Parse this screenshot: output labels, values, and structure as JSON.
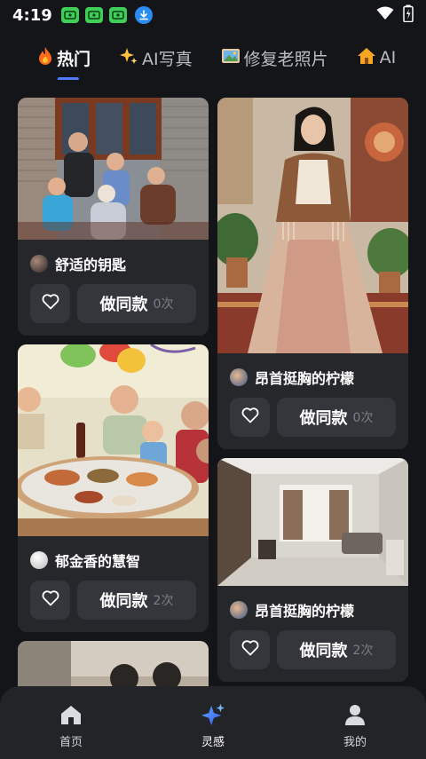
{
  "status_bar": {
    "time": "4:19",
    "notification_icons": [
      "cash-app-icon",
      "cash-app-icon",
      "cash-app-icon",
      "download-icon"
    ],
    "right_icons": [
      "wifi-icon",
      "battery-icon"
    ]
  },
  "tabs": [
    {
      "label": "热门",
      "icon": "fire-icon",
      "active": true
    },
    {
      "label": "AI写真",
      "icon": "sparkle-icon",
      "active": false
    },
    {
      "label": "修复老照片",
      "icon": "photo-icon",
      "active": false
    },
    {
      "label": "AI",
      "icon": "house-icon",
      "active": false
    }
  ],
  "feed": {
    "left": [
      {
        "author": "舒适的钥匙",
        "make_label": "做同款",
        "count": "0次",
        "image": "family-photo-outdoor"
      },
      {
        "author": "郁金香的慧智",
        "make_label": "做同款",
        "count": "2次",
        "image": "family-dinner-photo"
      },
      {
        "image": "old-photo-partial"
      }
    ],
    "right": [
      {
        "author": "昂首挺胸的柠檬",
        "make_label": "做同款",
        "count": "0次",
        "image": "bohemian-dress-portrait"
      },
      {
        "author": "昂首挺胸的柠檬",
        "make_label": "做同款",
        "count": "2次",
        "image": "modern-living-room"
      }
    ]
  },
  "bottom_nav": [
    {
      "label": "首页",
      "icon": "home-icon",
      "active": false
    },
    {
      "label": "灵感",
      "icon": "sparkle-icon",
      "active": true
    },
    {
      "label": "我的",
      "icon": "profile-icon",
      "active": false
    }
  ],
  "colors": {
    "background": "#141518",
    "card": "#26272b",
    "button": "#34363b",
    "accent": "#4f7cff",
    "muted_text": "#7b7e86"
  }
}
